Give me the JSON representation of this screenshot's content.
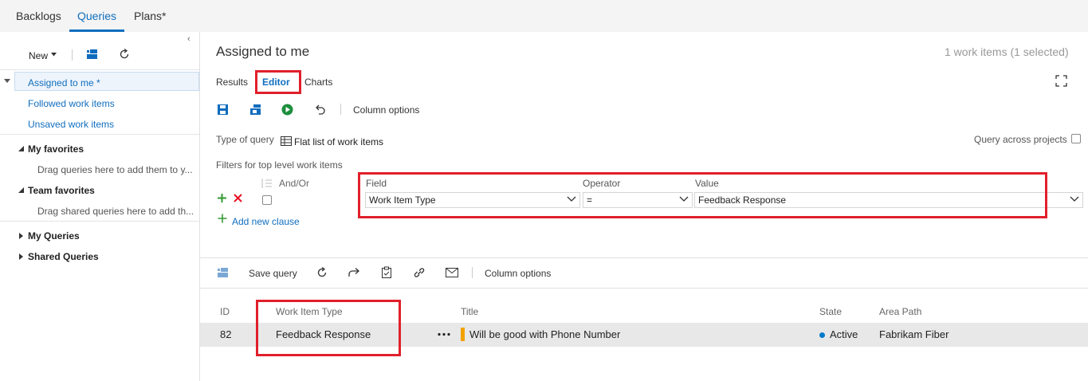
{
  "topnav": {
    "tabs": [
      {
        "label": "Backlogs"
      },
      {
        "label": "Queries"
      },
      {
        "label": "Plans*"
      }
    ]
  },
  "leftpane": {
    "new_label": "New",
    "items": [
      {
        "label": "Assigned to me *"
      },
      {
        "label": "Followed work items"
      },
      {
        "label": "Unsaved work items"
      }
    ],
    "my_favorites": "My favorites",
    "my_favorites_hint": "Drag queries here to add them to y...",
    "team_favorites": "Team favorites",
    "team_favorites_hint": "Drag shared queries here to add th...",
    "my_queries": "My Queries",
    "shared_queries": "Shared Queries"
  },
  "query": {
    "title": "Assigned to me",
    "count": "1 work items (1 selected)",
    "tabs": [
      {
        "label": "Results"
      },
      {
        "label": "Editor"
      },
      {
        "label": "Charts"
      }
    ],
    "column_options": "Column options",
    "type_of_query_label": "Type of query",
    "type_of_query_value": "Flat list of work items",
    "query_across_projects": "Query across projects",
    "filters_label": "Filters for top level work items",
    "and_or": "And/Or",
    "field_header": "Field",
    "operator_header": "Operator",
    "value_header": "Value",
    "field_value": "Work Item Type",
    "operator_value": "=",
    "value_value": "Feedback Response",
    "add_clause": "Add new clause"
  },
  "results_toolbar": {
    "save_query": "Save query",
    "column_options": "Column options"
  },
  "table": {
    "columns": [
      "ID",
      "Work Item Type",
      "Title",
      "State",
      "Area Path"
    ],
    "rows": [
      {
        "id": "82",
        "type": "Feedback Response",
        "title": "Will be good with Phone Number",
        "state": "Active",
        "area": "Fabrikam Fiber"
      }
    ]
  },
  "colors": {
    "accent": "#106ebe",
    "highlight_box": "#e0202b",
    "state_active": "#007acc",
    "work_item_bar": "#f2a200",
    "add_green": "#339933",
    "remove_red": "#e81123"
  }
}
